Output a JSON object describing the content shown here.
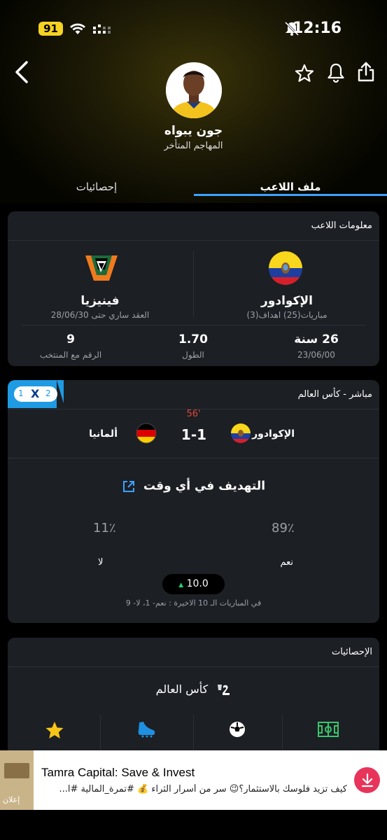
{
  "status": {
    "battery": "91",
    "time": "12:16"
  },
  "player": {
    "name": "جون يبواه",
    "position": "المهاجم المتأخر"
  },
  "tabs": {
    "stats": "إحصائيات",
    "profile": "ملف اللاعب"
  },
  "info": {
    "title": "معلومات اللاعب",
    "national_team": "الإكوادور",
    "national_sub": "مباريات(25) اهداف(3)",
    "club": "فينيزيا",
    "club_sub": "العقد ساري حتى 28/06/30",
    "age": "26 سنة",
    "dob": "23/06/00",
    "height": "1.70",
    "height_label": "الطول",
    "number": "9",
    "number_label": "الرقم مع المنتخب"
  },
  "live": {
    "title": "مباشر - كأس العالم",
    "badge": [
      "1",
      "X",
      "2"
    ],
    "minute": "56'",
    "home": "الإكوادور",
    "away": "ألمانيا",
    "score": "1-1"
  },
  "poll": {
    "title": "التهديف في أي وقت",
    "yes_pct": "89٪",
    "no_pct": "11٪",
    "yes_label": "نعم",
    "no_label": "لا",
    "odds": "10.0",
    "recent": "في المباريات الـ 10 الاخيرة : نعم- 1، لا- 9",
    "yes_share": 0.89
  },
  "stats": {
    "title": "الإحصائيات",
    "competition": "كأس العالم",
    "icons": [
      "pitch-icon",
      "ball-icon",
      "boot-icon",
      "star-icon"
    ]
  },
  "ad": {
    "title": "Tamra Capital: Save & Invest",
    "text": "كيف تزيد فلوسك بالاستثمار؟😉 سر من أسرار الثراء 💰 #تمرة_المالية #ا...",
    "badge": "إعلان"
  },
  "colors": {
    "accent": "#3ea2ff",
    "brand_yellow": "#f5d223",
    "card": "#1c1f24",
    "ad_red": "#e8345a"
  }
}
